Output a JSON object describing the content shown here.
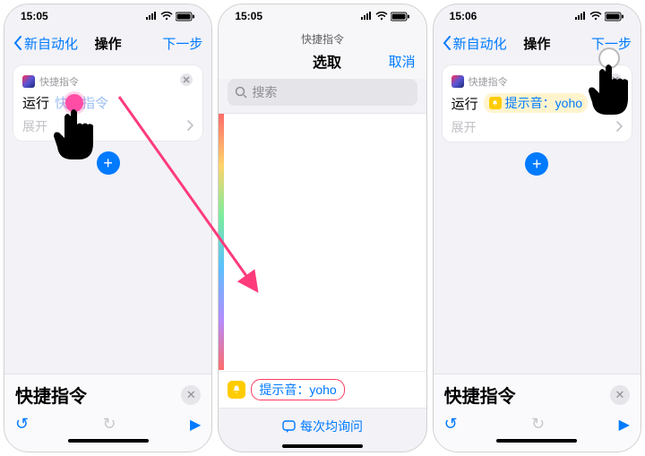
{
  "phone1": {
    "time": "15:05",
    "back": "新自动化",
    "title": "操作",
    "next": "下一步",
    "card_app": "快捷指令",
    "run": "运行",
    "placeholder": "快捷指令",
    "expand": "展开",
    "bottom_title": "快捷指令"
  },
  "phone2": {
    "time": "15:05",
    "header_small": "快捷指令",
    "picker_title": "选取",
    "cancel": "取消",
    "search_ph": "搜索",
    "result_label": "提示音：yoho",
    "ask_each": "每次均询问"
  },
  "phone3": {
    "time": "15:06",
    "back": "新自动化",
    "title": "操作",
    "next": "下一步",
    "card_app": "快捷指令",
    "run": "运行",
    "selected": "提示音：yoho",
    "expand": "展开",
    "bottom_title": "快捷指令"
  }
}
